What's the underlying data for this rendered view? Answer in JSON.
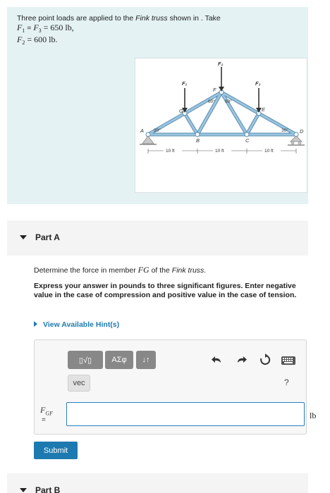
{
  "problem": {
    "intro": "Three point loads are applied to the",
    "truss_name": "Fink truss",
    "intro_tail": "shown in . Take",
    "line1_var": "F",
    "line1_sub1": "1",
    "line1_mid": " = ",
    "line1_var2": "F",
    "line1_sub2": "3",
    "line1_val": " = 650 lb,",
    "line2_var": "F",
    "line2_sub": "2",
    "line2_val": " = 600 lb."
  },
  "figure": {
    "labels": {
      "f1": "F₁",
      "f2": "F₂",
      "f3": "F₃",
      "a": "A",
      "b": "B",
      "c": "C",
      "d": "D",
      "e": "E",
      "f": "F",
      "g": "G",
      "ang_left": "30°",
      "ang_f1": "60°",
      "ang_f2": "60°",
      "ang_right": "30°",
      "dim1": "10 ft",
      "dim2": "10 ft",
      "dim3": "10 ft"
    },
    "colors": {
      "member": "#9bc4de",
      "member_edge": "#5a8fb3",
      "load": "#333333"
    }
  },
  "part_a": {
    "label": "Part A",
    "question_prefix": "Determine the force in member",
    "member": "FG",
    "question_mid": "of the",
    "question_truss": "Fink truss",
    "question_end": ".",
    "instruction": "Express your answer in pounds to three significant figures. Enter negative value in the case of compression and positive value in the case of tension.",
    "hint_link": "View Available Hint(s)",
    "toolbar": {
      "templates_label": "▯√▯",
      "greek_label": "ΑΣφ",
      "arrows_label": "↓↑",
      "vec_label": "vec",
      "help_label": "?"
    },
    "var_symbol": "F",
    "var_sub": "GF",
    "var_eq": "=",
    "input_value": "",
    "unit": "lb",
    "submit_label": "Submit"
  },
  "part_b": {
    "label": "Part B"
  }
}
